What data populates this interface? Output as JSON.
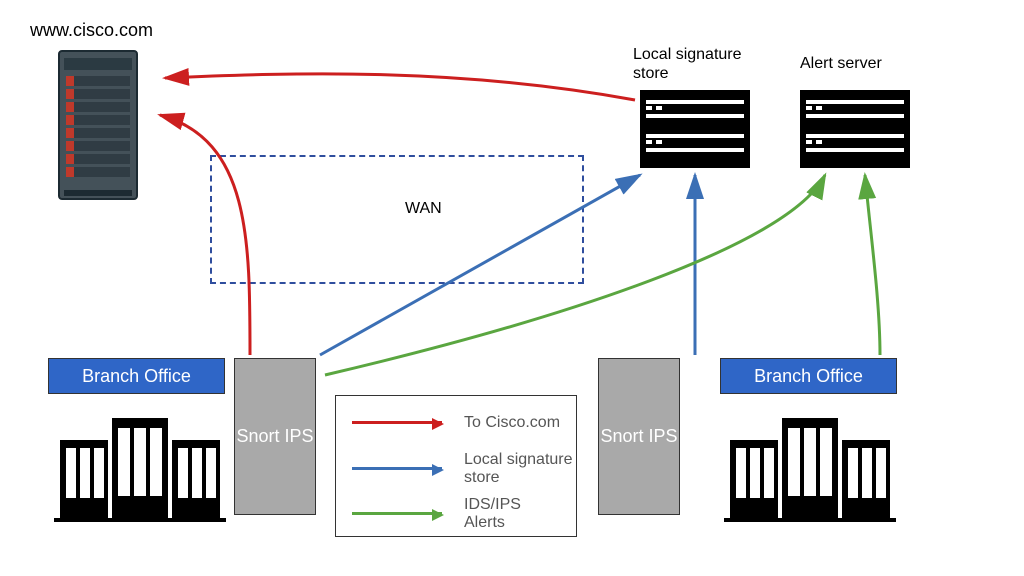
{
  "title": "www.cisco.com",
  "servers": {
    "sig_store": "Local signature\nstore",
    "alert": "Alert server"
  },
  "wan": {
    "label": "WAN"
  },
  "branch": {
    "left": "Branch Office",
    "right": "Branch Office",
    "snort": "Snort\nIPS"
  },
  "legend": {
    "red": {
      "color": "#cc1f1f",
      "text": "To Cisco.com"
    },
    "blue": {
      "color": "#3b6fb5",
      "text": "Local signature\nstore"
    },
    "green": {
      "color": "#5aa640",
      "text": "IDS/IPS\nAlerts"
    }
  },
  "icons": {
    "cisco_server": "server-tower-icon",
    "rack": "server-rack-icon",
    "building": "office-buildings-icon"
  }
}
